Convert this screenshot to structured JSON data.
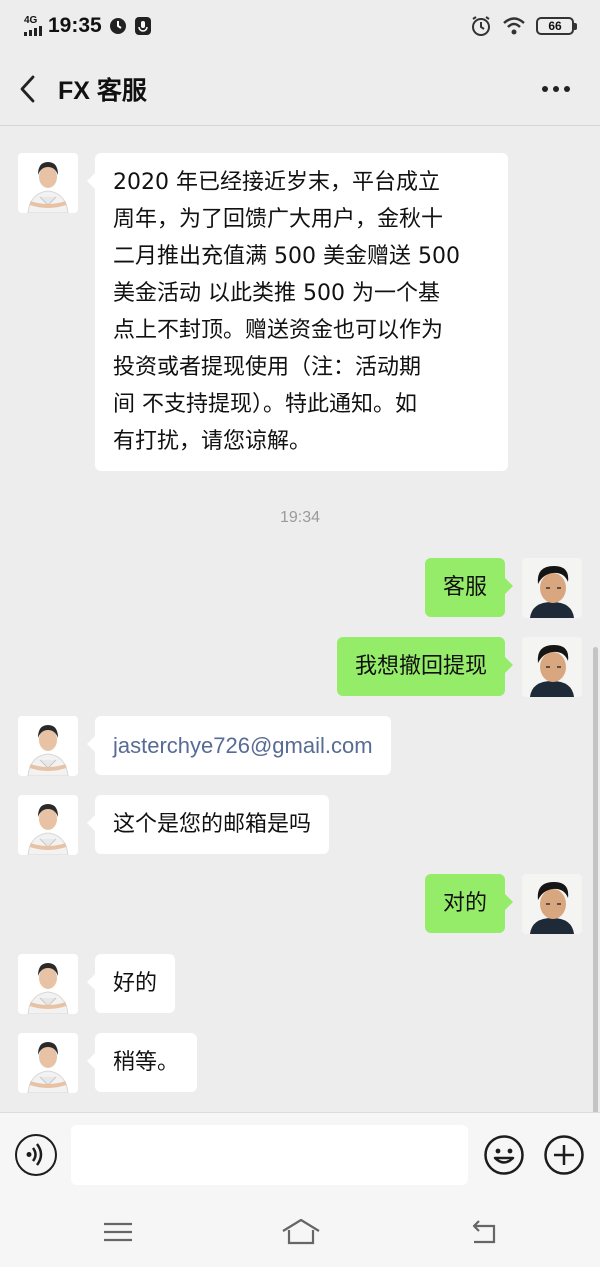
{
  "status_bar": {
    "network": "4G",
    "time": "19:35",
    "battery": "66"
  },
  "header": {
    "title": "FX 客服"
  },
  "messages": [
    {
      "side": "in",
      "text": "2020 年已经接近岁末，平台成立周年，为了回馈广大用户，金秋十二月推出充值满 500 美金赠送 500 美金活动 以此类推 500 为一个基点上不封顶。赠送资金也可以作为投资或者提现使用（注：活动期间 不支持提现）。特此通知。如有打扰，请您谅解。"
    },
    {
      "type": "timestamp",
      "text": "19:34"
    },
    {
      "side": "out",
      "text": "客服"
    },
    {
      "side": "out",
      "text": "我想撤回提现"
    },
    {
      "side": "in",
      "text": "jasterchye726@gmail.com"
    },
    {
      "side": "in",
      "text": "这个是您的邮箱是吗"
    },
    {
      "side": "out",
      "text": "对的"
    },
    {
      "side": "in",
      "text": "好的"
    },
    {
      "side": "in",
      "text": "稍等。"
    }
  ],
  "message_lines": {
    "m0": [
      "2020 年已经接近岁末，平台成立",
      "周年，为了回馈广大用户，金秋十",
      "二月推出充值满 500 美金赠送 500",
      "美金活动 以此类推 500 为一个基",
      "点上不封顶。赠送资金也可以作为",
      "投资或者提现使用（注：活动期",
      "间 不支持提现）。特此通知。如",
      "有打扰，请您谅解。"
    ]
  },
  "colors": {
    "background": "#ededed",
    "incoming_bubble": "#ffffff",
    "outgoing_bubble": "#95ec69",
    "link_text": "#576b95",
    "timestamp_text": "#9a9a9a"
  },
  "icons": {
    "back": "chevron-left-icon",
    "more": "more-dots-icon",
    "voice": "voice-icon",
    "emoji": "emoji-icon",
    "plus": "plus-icon",
    "nav_menu": "menu-icon",
    "nav_home": "home-icon",
    "nav_back": "return-icon"
  }
}
